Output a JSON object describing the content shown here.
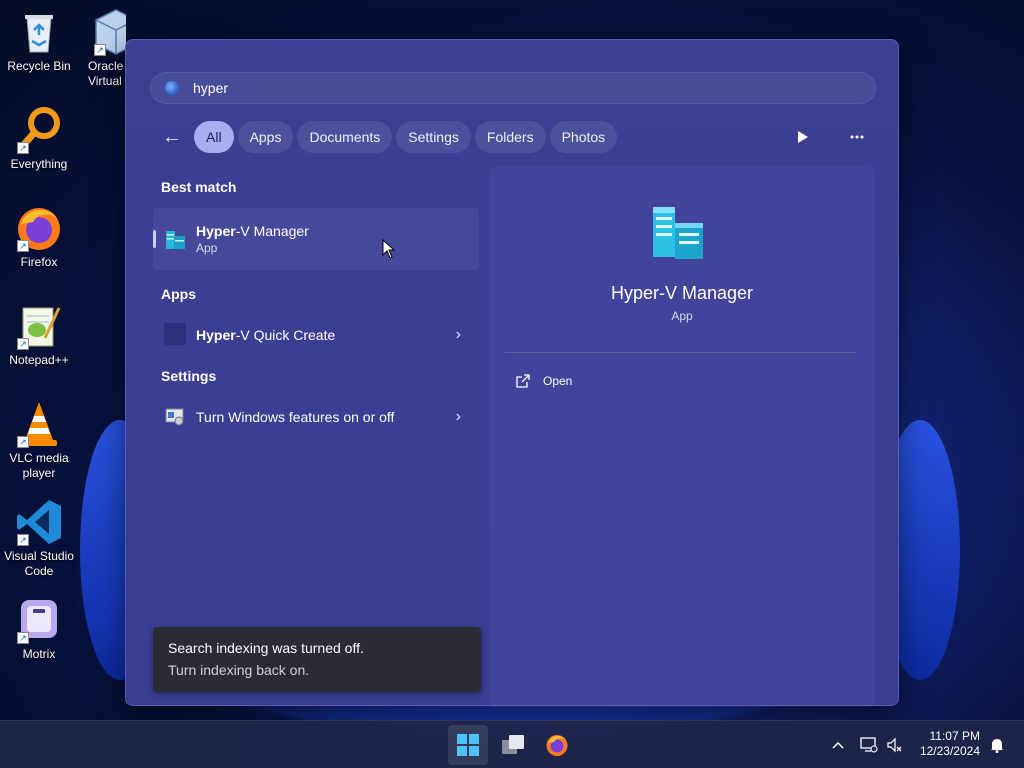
{
  "desktop": {
    "icons": [
      {
        "label": "Recycle Bin"
      },
      {
        "label": "Oracle Virtual"
      },
      {
        "label": "Everything"
      },
      {
        "label": "Firefox"
      },
      {
        "label": "Notepad++"
      },
      {
        "label": "VLC media player"
      },
      {
        "label": "Visual Studio Code"
      },
      {
        "label": "Motrix"
      }
    ]
  },
  "search": {
    "query": "hyper",
    "icon": "search-icon"
  },
  "tabs": {
    "back_icon": "arrow-left-icon",
    "items": [
      {
        "label": "All",
        "active": true
      },
      {
        "label": "Apps"
      },
      {
        "label": "Documents"
      },
      {
        "label": "Settings"
      },
      {
        "label": "Folders"
      },
      {
        "label": "Photos"
      }
    ],
    "play_icon": "play-icon",
    "more_icon": "more-icon"
  },
  "results": {
    "best_match_heading": "Best match",
    "best": {
      "name_bold": "Hyper",
      "name_rest": "-V Manager",
      "sub": "App"
    },
    "apps_heading": "Apps",
    "apps": [
      {
        "name_bold": "Hyper",
        "name_rest": "-V Quick Create"
      }
    ],
    "settings_heading": "Settings",
    "settings": [
      {
        "name": "Turn Windows features on or off"
      }
    ]
  },
  "detail": {
    "title": "Hyper-V Manager",
    "subtitle": "App",
    "actions": [
      {
        "label": "Open",
        "icon": "open-external-icon"
      }
    ]
  },
  "toast": {
    "message": "Search indexing was turned off.",
    "link": "Turn indexing back on."
  },
  "taskbar": {
    "apps": [
      "start-icon",
      "task-view-icon",
      "firefox-icon"
    ],
    "tray": [
      "chevron-up-icon",
      "network-icon",
      "volume-mute-icon"
    ],
    "time": "11:07 PM",
    "date": "12/23/2024",
    "notification_icon": "bell-icon"
  },
  "colors": {
    "panel_bg": "#3c3f92",
    "tab_active": "#a9aef0",
    "accent": "#2a5cc4"
  }
}
